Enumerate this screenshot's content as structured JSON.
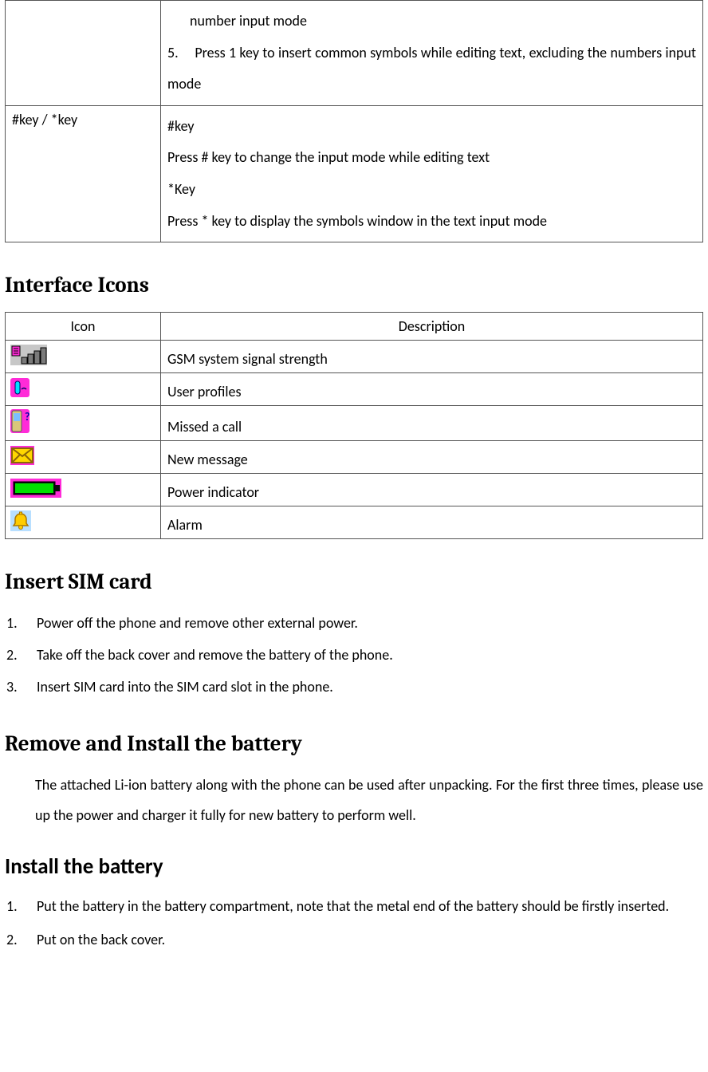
{
  "keys_table": {
    "row1_col2_line_indent": "number input mode",
    "row1_col2_num5": "5.",
    "row1_col2_line5": "Press 1 key to insert common symbols while editing text, excluding the numbers input mode",
    "row2_col1": "#key / *key",
    "row2_p1": "#key",
    "row2_p2": "Press # key to change the input mode while editing text",
    "row2_p3": "*Key",
    "row2_p4": "Press * key to display the symbols window in the text input mode"
  },
  "heading_interface_icons": "Interface Icons",
  "icons_table": {
    "hdr_icon": "Icon",
    "hdr_desc": "Description",
    "r1_desc": "GSM system signal strength",
    "r2_desc": "User profiles",
    "r3_desc": "Missed a call",
    "r4_desc": "New message",
    "r5_desc": "Power indicator",
    "r6_desc": "Alarm"
  },
  "heading_insert_sim": "Insert SIM card",
  "sim_steps": {
    "n1": "1.",
    "t1": "Power off the phone and remove other external power.",
    "n2": "2.",
    "t2": "Take off the back cover and remove the battery of the phone.",
    "n3": "3.",
    "t3": "Insert SIM card into the SIM card slot in the phone."
  },
  "heading_remove_install": "Remove and Install the battery",
  "battery_para": "The attached Li-ion battery along with the phone can be used after unpacking. For the first three times, please use up the power and charger it fully for new battery to perform well.",
  "heading_install_battery": "Install the battery",
  "install_steps": {
    "n1": "1.",
    "t1": "Put the battery in the battery compartment, note that the metal end of the battery should be firstly inserted.",
    "n2": "2.",
    "t2": "Put on the back cover."
  }
}
